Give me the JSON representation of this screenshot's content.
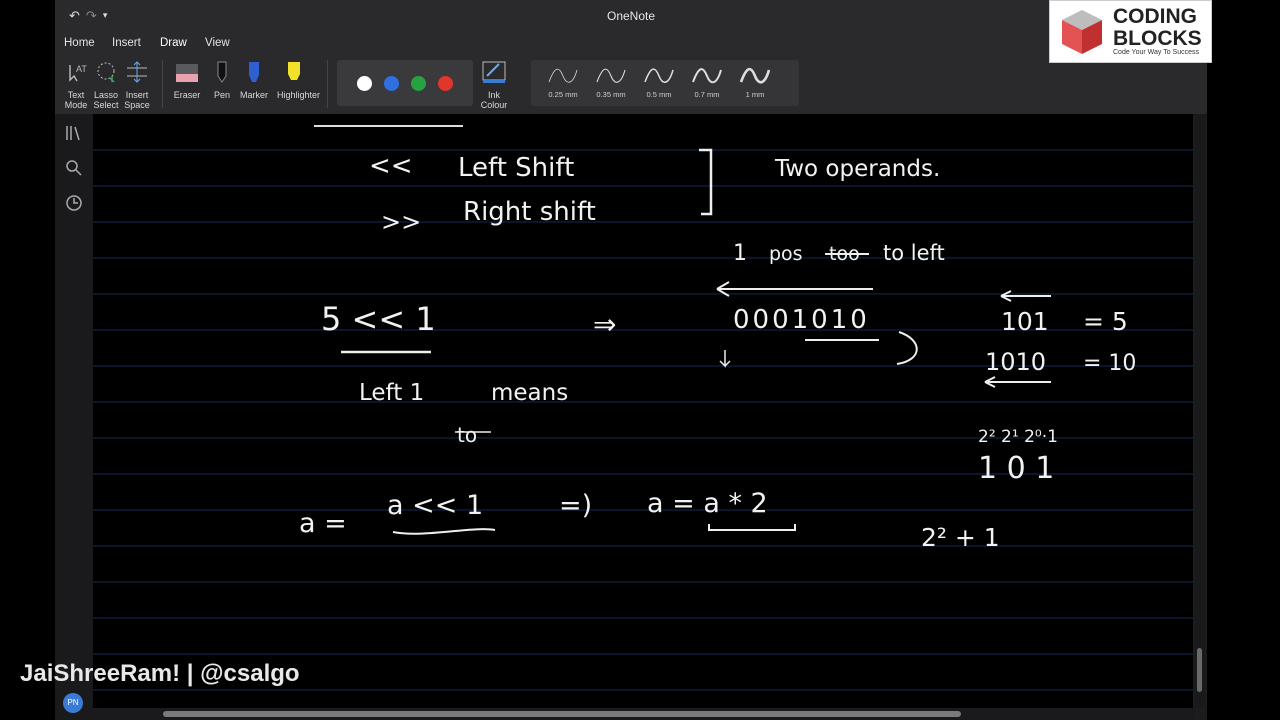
{
  "window": {
    "title": "OneNote"
  },
  "quick_access": {
    "undo": "↶",
    "redo": "↷",
    "more": "▾"
  },
  "tabs": [
    {
      "label": "Home"
    },
    {
      "label": "Insert"
    },
    {
      "label": "Draw",
      "active": true
    },
    {
      "label": "View"
    }
  ],
  "ribbon": {
    "text_mode": "Text Mode",
    "lasso_select": "Lasso Select",
    "insert_space": "Insert Space",
    "eraser": "Eraser",
    "pen": "Pen",
    "marker": "Marker",
    "highlighter": "Highlighter",
    "ink_colour": "Ink Colour",
    "colors": [
      "#ffffff",
      "#2f6fe0",
      "#27a243",
      "#e0362c"
    ],
    "thickness": [
      "0.25 mm",
      "0.35 mm",
      "0.5 mm",
      "0.7 mm",
      "1 mm"
    ]
  },
  "sidebar": {
    "icons": [
      "library-icon",
      "search-icon",
      "history-icon"
    ]
  },
  "notes": {
    "l1a": "<<",
    "l1b": "Left Shift",
    "l2a": ">>",
    "l2b": "Right shift",
    "operands": "Two operands.",
    "pos1": "1",
    "pos2": "pos",
    "pos3": "too",
    "pos4": "to left",
    "expr": "5 << 1",
    "arrow1": "⇒",
    "binary": "0001010",
    "r1a": "101",
    "r1b": "= 5",
    "r2a": "1010",
    "r2b": "= 10",
    "left1": "Left 1",
    "means": "means",
    "scratch": "to",
    "pow": "2² 2¹ 2⁰·1",
    "bits": "1 0 1",
    "a1": "a =",
    "a2": "a << 1",
    "arrow2": "=)",
    "a3": "a = a * 2",
    "sum": "2² + 1"
  },
  "logo": {
    "line1": "CODING",
    "line2": "BLOCKS",
    "tagline": "Code Your Way To Success"
  },
  "watermark": "JaiShreeRam! | @csalgo",
  "user": {
    "initials": "PN"
  }
}
